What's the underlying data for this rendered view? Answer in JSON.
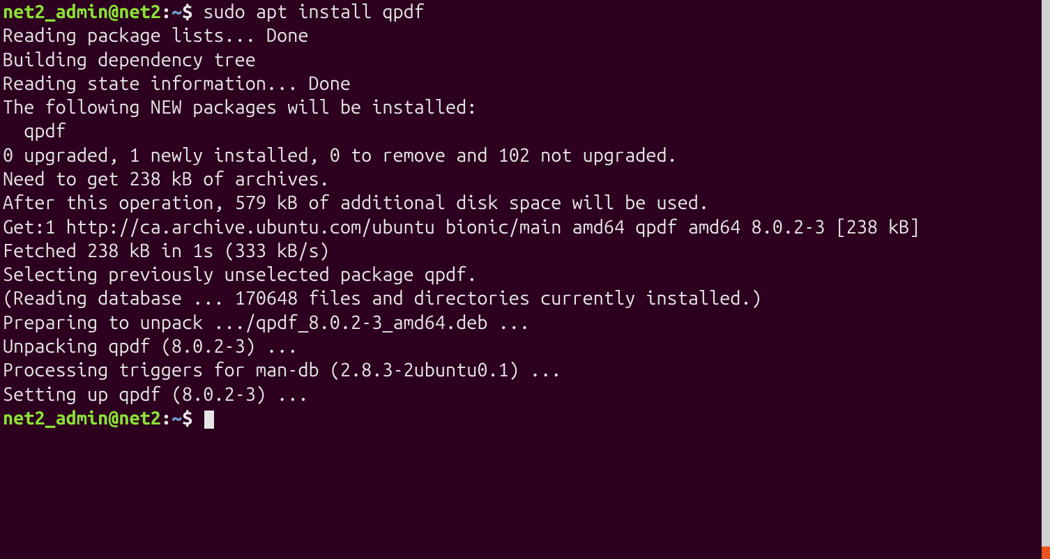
{
  "prompt": {
    "user_host": "net2_admin@net2",
    "sep1": ":",
    "path": "~",
    "sep2": "$ "
  },
  "command": "sudo apt install qpdf",
  "output": [
    "Reading package lists... Done",
    "Building dependency tree",
    "Reading state information... Done",
    "The following NEW packages will be installed:",
    "  qpdf",
    "0 upgraded, 1 newly installed, 0 to remove and 102 not upgraded.",
    "Need to get 238 kB of archives.",
    "After this operation, 579 kB of additional disk space will be used.",
    "Get:1 http://ca.archive.ubuntu.com/ubuntu bionic/main amd64 qpdf amd64 8.0.2-3 [238 kB]",
    "Fetched 238 kB in 1s (333 kB/s)",
    "Selecting previously unselected package qpdf.",
    "(Reading database ... 170648 files and directories currently installed.)",
    "Preparing to unpack .../qpdf_8.0.2-3_amd64.deb ...",
    "Unpacking qpdf (8.0.2-3) ...",
    "Processing triggers for man-db (2.8.3-2ubuntu0.1) ...",
    "Setting up qpdf (8.0.2-3) ..."
  ],
  "colors": {
    "bg": "#2c001e",
    "fg": "#e6e6e6",
    "prompt_green": "#8ae234",
    "prompt_blue": "#729fcf",
    "accent": "#e95420"
  }
}
